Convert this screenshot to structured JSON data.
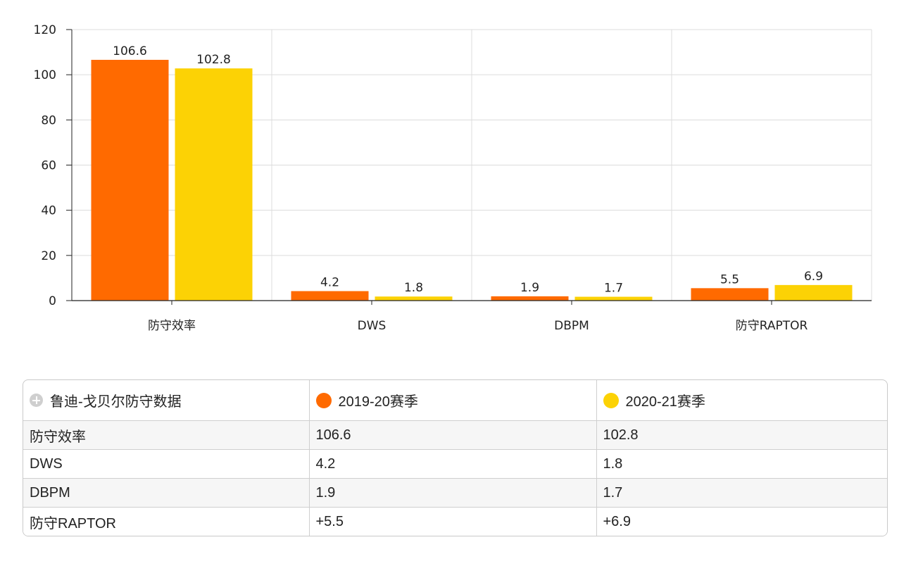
{
  "chart_data": {
    "type": "bar",
    "categories": [
      "防守效率",
      "DWS",
      "DBPM",
      "防守RAPTOR"
    ],
    "series": [
      {
        "name": "2019-20赛季",
        "color": "#FF6A00",
        "values": [
          106.6,
          4.2,
          1.9,
          5.5
        ]
      },
      {
        "name": "2020-21赛季",
        "color": "#FCD205",
        "values": [
          102.8,
          1.8,
          1.7,
          6.9
        ]
      }
    ],
    "ylim": [
      0,
      120
    ],
    "yticks": [
      "0",
      "20",
      "40",
      "60",
      "80",
      "100",
      "120"
    ],
    "grid": true,
    "xlabel": "",
    "ylabel": ""
  },
  "table": {
    "corner_icon": "plus-circle-icon",
    "corner_label": "鲁迪-戈贝尔防守数据",
    "headers": [
      "2019-20赛季",
      "2020-21赛季"
    ],
    "rows": [
      {
        "label": "防守效率",
        "v1": "106.6",
        "v2": "102.8"
      },
      {
        "label": "DWS",
        "v1": "4.2",
        "v2": "1.8"
      },
      {
        "label": "DBPM",
        "v1": "1.9",
        "v2": "1.7"
      },
      {
        "label": "防守RAPTOR",
        "v1": "+5.5",
        "v2": "+6.9"
      }
    ]
  }
}
